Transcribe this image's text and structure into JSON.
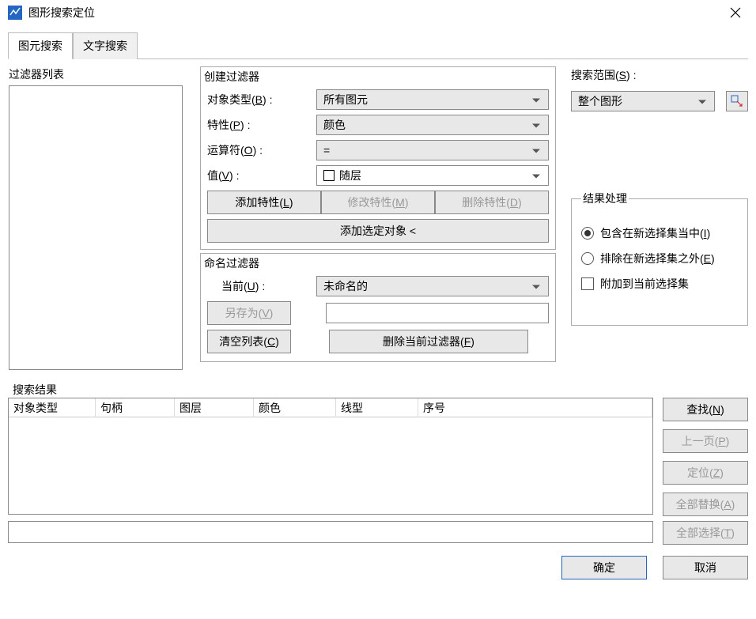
{
  "title": "图形搜索定位",
  "tabs": {
    "entity_search": "图元搜索",
    "text_search": "文字搜索"
  },
  "filter_list": {
    "label": "过滤器列表"
  },
  "create_filter": {
    "legend": "创建过滤器",
    "object_type_label": "对象类型(B) :",
    "object_type_value": "所有图元",
    "property_label": "特性(P) :",
    "property_value": "颜色",
    "operator_label": "运算符(O) :",
    "operator_value": "=",
    "value_label": "值(V) :",
    "value_value": "随层",
    "add_property_btn": "添加特性(L)",
    "modify_property_btn": "修改特性(M)",
    "delete_property_btn": "删除特性(D)",
    "add_selected_btn": "添加选定对象 <"
  },
  "name_filter": {
    "legend": "命名过滤器",
    "current_label": "当前(U) :",
    "current_value": "未命名的",
    "save_as_btn": "另存为(V)",
    "clear_list_btn": "清空列表(C)",
    "delete_current_btn": "删除当前过滤器(F)"
  },
  "search_range": {
    "label": "搜索范围(S) :",
    "value": "整个图形"
  },
  "result_handling": {
    "legend": "结果处理",
    "include_radio": "包含在新选择集当中(I)",
    "exclude_radio": "排除在新选择集之外(E)",
    "append_check": "附加到当前选择集"
  },
  "search_results": {
    "legend": "搜索结果",
    "columns": {
      "object_type": "对象类型",
      "handle": "句柄",
      "layer": "图层",
      "color": "颜色",
      "linetype": "线型",
      "index": "序号"
    },
    "find_btn": "查找(N)",
    "prev_page_btn": "上一页(P)",
    "locate_btn": "定位(Z)",
    "replace_all_btn": "全部替换(A)",
    "select_all_btn": "全部选择(T)"
  },
  "dialog": {
    "ok": "确定",
    "cancel": "取消"
  }
}
